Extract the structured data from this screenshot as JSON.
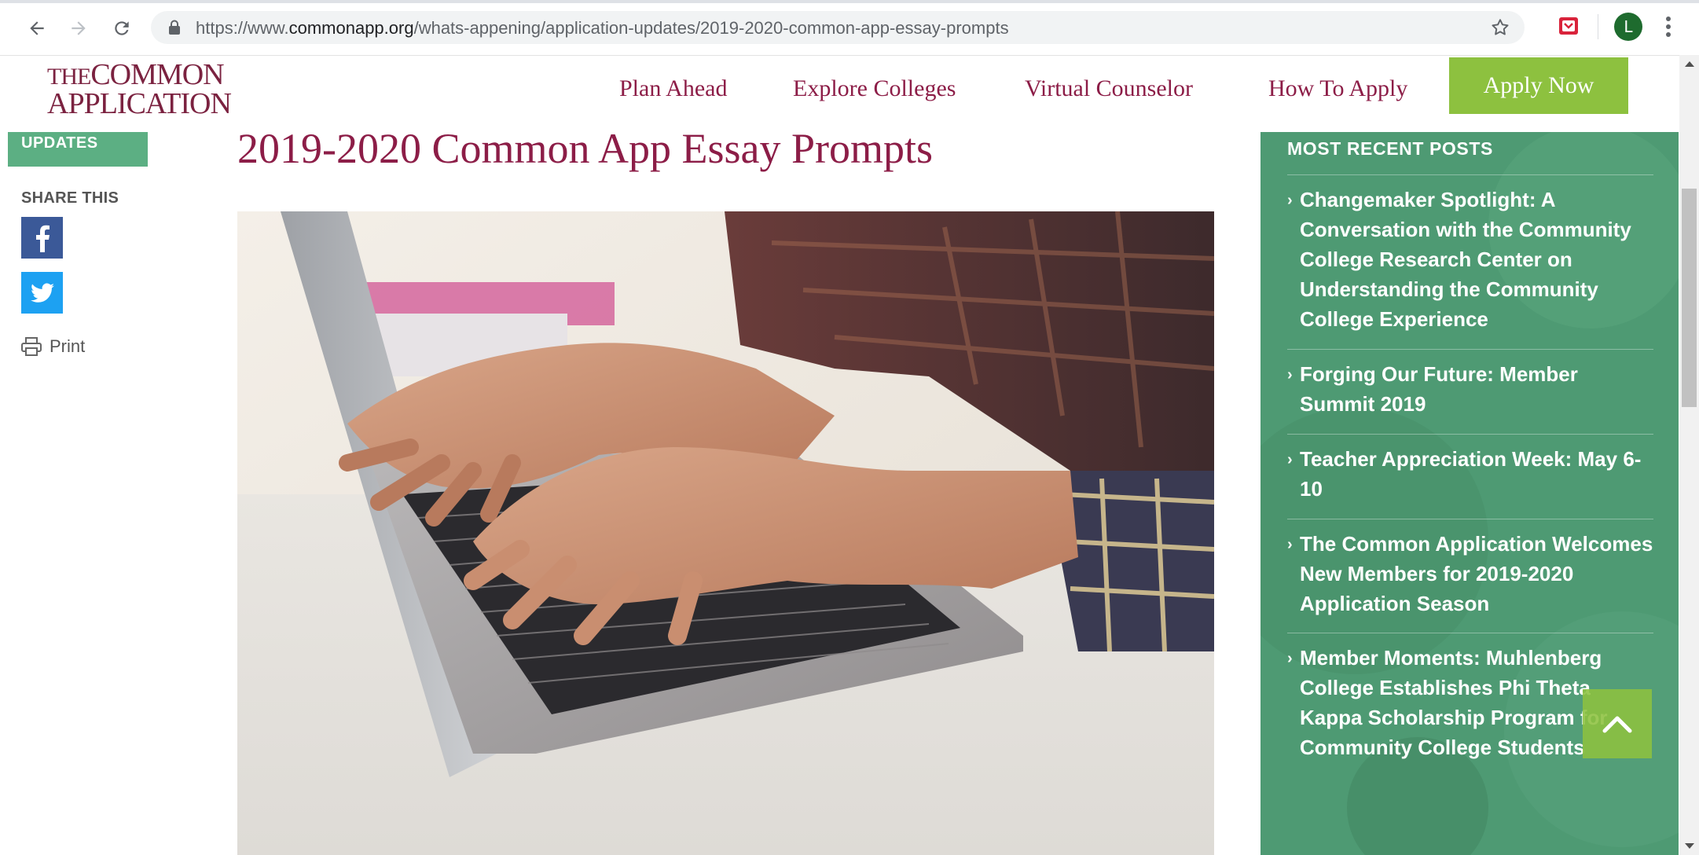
{
  "browser": {
    "url_scheme": "https://www.",
    "url_host": "commonapp.org",
    "url_path": "/whats-appening/application-updates/2019-2020-common-app-essay-prompts",
    "avatar_letter": "L"
  },
  "site": {
    "logo_line1_a": "THE",
    "logo_line1_b": "COMMON",
    "logo_line2": "APPLICATION",
    "nav": [
      "Plan Ahead",
      "Explore Colleges",
      "Virtual Counselor",
      "How To Apply"
    ],
    "apply_label": "Apply Now"
  },
  "left_rail": {
    "updates_label": "UPDATES",
    "share_title": "SHARE THIS",
    "print_label": "Print"
  },
  "article": {
    "title": "2019-2020 Common App Essay Prompts"
  },
  "sidebar": {
    "title": "MOST RECENT POSTS",
    "posts": [
      "Changemaker Spotlight: A Conversation with the Community College Research Center on Understanding the Community College Experience",
      "Forging Our Future: Member Summit 2019",
      "Teacher Appreciation Week: May 6-10",
      "The Common Application Welcomes New Members for 2019-2020 Application Season",
      "Member Moments: Muhlenberg College Establishes Phi Theta Kappa Scholarship Program for Community College Students"
    ]
  },
  "colors": {
    "brand_maroon": "#8c1d47",
    "apply_green": "#8dc13f",
    "sidebar_green": "#4e9a73",
    "updates_green": "#5caf83"
  },
  "icons": [
    "back-icon",
    "forward-icon",
    "reload-icon",
    "lock-icon",
    "star-icon",
    "extension-icon",
    "kebab-menu-icon",
    "facebook-icon",
    "twitter-icon",
    "printer-icon",
    "chevron-right-icon",
    "chevron-up-icon"
  ]
}
